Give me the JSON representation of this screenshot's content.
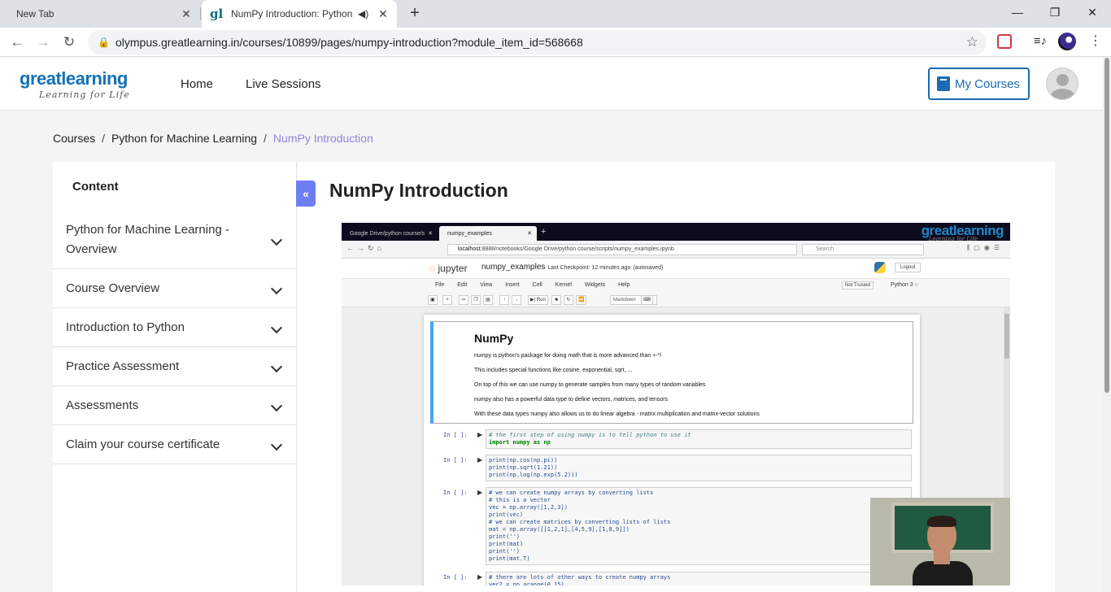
{
  "browser": {
    "tabs": [
      {
        "title": "New Tab"
      },
      {
        "title": "NumPy Introduction: Python"
      }
    ],
    "url": "olympus.greatlearning.in/courses/10899/pages/numpy-introduction?module_item_id=568668"
  },
  "header": {
    "logo_word": "greatlearning",
    "logo_tagline": "Learning for Life",
    "nav": [
      "Home",
      "Live Sessions"
    ],
    "my_courses_label": "My Courses"
  },
  "breadcrumb": [
    "Courses",
    "Python for Machine Learning",
    "NumPy Introduction"
  ],
  "sidebar": {
    "title": "Content",
    "modules": [
      "Python for Machine Learning - Overview",
      "Course Overview",
      "Introduction to Python",
      "Practice Assessment",
      "Assessments",
      "Claim your course certificate"
    ]
  },
  "main": {
    "title": "NumPy Introduction"
  },
  "video": {
    "tabs": [
      "Google Drive/python course/s",
      "numpy_examples"
    ],
    "brand": "greatlearning",
    "brand_tagline": "Learning for Life",
    "url_host": "localhost",
    "url_rest": ":8888/notebooks/Google Drive/python course/scripts/numpy_examples.ipynb",
    "search_placeholder": "Search",
    "jupyter_label": "jupyter",
    "notebook_name": "numpy_examples",
    "checkpoint": "Last Checkpoint: 12 minutes ago",
    "autosaved": "(autosaved)",
    "logout": "Logout",
    "menu": "File Edit View Insert Cell Kernel Widgets Help",
    "not_trusted": "Not Trusted",
    "kernel": "Python 3",
    "run_label": "Run",
    "cell_type": "Markdown",
    "md_title": "NumPy",
    "md_lines": [
      "numpy is python's package for doing math that is more advanced than +-*/",
      "This includes special functions like cosine, exponential, sqrt, ...",
      "On top of this we can use numpy to generate samples from many types of random variables",
      "numpy also has a powerful data type to define vectors, matrices, and tensors",
      "With these data types numpy also allows us to do linear algebra - matrix multiplication and matrix-vector solutions"
    ],
    "prompt": "In [ ]:",
    "cells": [
      {
        "comment": "# the first step of using numpy is to tell python to use it",
        "code": "import numpy as np"
      },
      {
        "code": "print(np.cos(np.pi))\nprint(np.sqrt(1.21))\nprint(np.log(np.exp(5.2)))"
      },
      {
        "code": "# we can create numpy arrays by converting lists\n# this is a vector\nvec = np.array([1,2,3])\nprint(vec)\n# we can create matrices by converting lists of lists\nmat = np.array([[1,2,1],[4,5,9],[1,8,9]])\nprint('')\nprint(mat)\nprint('')\nprint(mat.T)"
      },
      {
        "code": "# there are lots of other ways to create numpy arrays\nvec2 = np.arange(0,15)"
      }
    ]
  }
}
